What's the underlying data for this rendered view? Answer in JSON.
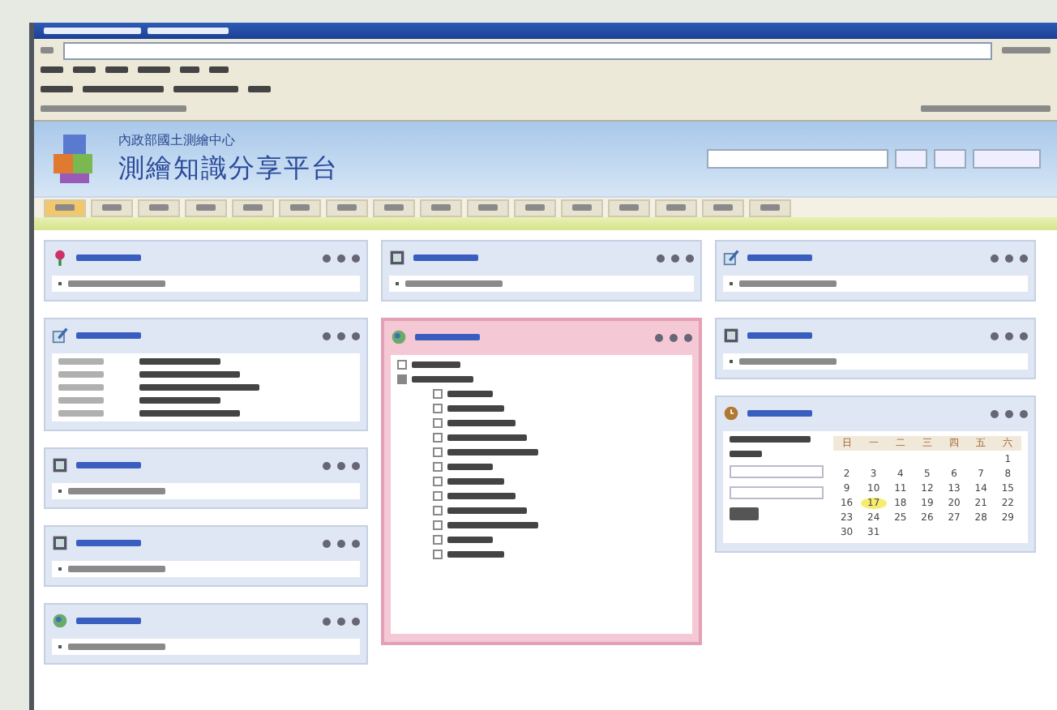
{
  "header": {
    "organization": "內政部國土測繪中心",
    "title": "測繪知識分享平台"
  },
  "nav_tabs": [
    {
      "selected": true
    },
    {
      "selected": false
    },
    {
      "selected": false
    },
    {
      "selected": false
    },
    {
      "selected": false
    },
    {
      "selected": false
    },
    {
      "selected": false
    },
    {
      "selected": false
    },
    {
      "selected": false
    },
    {
      "selected": false
    },
    {
      "selected": false
    },
    {
      "selected": false
    },
    {
      "selected": false
    },
    {
      "selected": false
    },
    {
      "selected": false
    },
    {
      "selected": false
    }
  ],
  "columns": [
    {
      "portlets": [
        {
          "kind": "list"
        },
        {
          "kind": "news"
        },
        {
          "kind": "list"
        },
        {
          "kind": "list"
        },
        {
          "kind": "list"
        }
      ]
    },
    {
      "portlets": [
        {
          "kind": "list"
        },
        {
          "kind": "tree",
          "highlighted": true,
          "tree": [
            {
              "expanded": false
            },
            {
              "expanded": true,
              "children": [
                {
                  "expanded": false
                },
                {
                  "expanded": false
                },
                {
                  "expanded": false
                },
                {
                  "expanded": false
                },
                {
                  "expanded": false
                },
                {
                  "expanded": false
                },
                {
                  "expanded": false
                },
                {
                  "expanded": false
                },
                {
                  "expanded": false
                },
                {
                  "expanded": false
                },
                {
                  "expanded": false
                },
                {
                  "expanded": false
                }
              ]
            }
          ]
        }
      ]
    },
    {
      "portlets": [
        {
          "kind": "list"
        },
        {
          "kind": "list"
        },
        {
          "kind": "calendar",
          "calendar": {
            "weekdays": [
              "日",
              "一",
              "二",
              "三",
              "四",
              "五",
              "六"
            ],
            "weeks": [
              [
                {
                  "day": "1",
                  "selected": false
                }
              ],
              [
                {
                  "day": "2",
                  "selected": false
                },
                {
                  "day": "3",
                  "selected": false
                },
                {
                  "day": "4",
                  "selected": false
                },
                {
                  "day": "5",
                  "selected": false
                },
                {
                  "day": "6",
                  "selected": false
                },
                {
                  "day": "7",
                  "selected": false
                },
                {
                  "day": "8",
                  "selected": false
                }
              ],
              [
                {
                  "day": "9",
                  "selected": false
                },
                {
                  "day": "10",
                  "selected": false
                },
                {
                  "day": "11",
                  "selected": false
                },
                {
                  "day": "12",
                  "selected": false
                },
                {
                  "day": "13",
                  "selected": false
                },
                {
                  "day": "14",
                  "selected": false
                },
                {
                  "day": "15",
                  "selected": false
                }
              ],
              [
                {
                  "day": "16",
                  "selected": false
                },
                {
                  "day": "17",
                  "selected": true
                },
                {
                  "day": "18",
                  "selected": false
                },
                {
                  "day": "19",
                  "selected": false
                },
                {
                  "day": "20",
                  "selected": false
                },
                {
                  "day": "21",
                  "selected": false
                },
                {
                  "day": "22",
                  "selected": false
                }
              ],
              [
                {
                  "day": "23",
                  "selected": false
                },
                {
                  "day": "24",
                  "selected": false
                },
                {
                  "day": "25",
                  "selected": false
                },
                {
                  "day": "26",
                  "selected": false
                },
                {
                  "day": "27",
                  "selected": false
                },
                {
                  "day": "28",
                  "selected": false
                },
                {
                  "day": "29",
                  "selected": false
                }
              ],
              [
                {
                  "day": "30",
                  "selected": false
                },
                {
                  "day": "31",
                  "selected": false
                }
              ]
            ]
          }
        }
      ]
    }
  ]
}
